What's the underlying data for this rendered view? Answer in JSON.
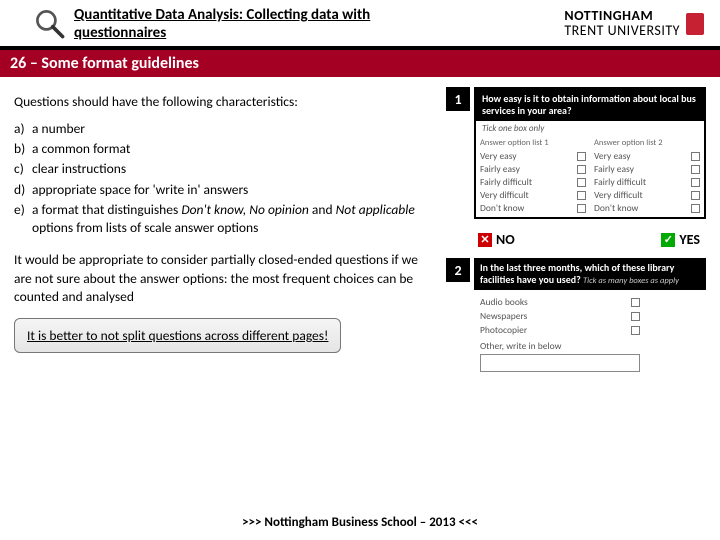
{
  "header": {
    "title": "Quantitative Data Analysis: Collecting data with questionnaires",
    "university_l1": "NOTTINGHAM",
    "university_l2": "TRENT UNIVERSITY"
  },
  "slide_title": "26 – Some format guidelines",
  "left": {
    "intro": "Questions should have the following characteristics:",
    "items": [
      {
        "k": "a)",
        "v": "a number"
      },
      {
        "k": "b)",
        "v": "a common format"
      },
      {
        "k": "c)",
        "v": "clear instructions"
      },
      {
        "k": "d)",
        "v": "appropriate space for 'write in' answers"
      },
      {
        "k": "e)",
        "v_pre": "a format that distinguishes ",
        "v_ital": "Don't know, No opinion",
        "v_mid": " and ",
        "v_ital2": "Not applicable",
        "v_post": " options from lists of scale answer options"
      }
    ],
    "para2": "It would be appropriate to consider partially closed-ended questions if we are not sure about the answer options: the most frequent choices can be counted and analysed",
    "callout": "It is better to not split questions across different pages!"
  },
  "right": {
    "ex1": {
      "num": "1",
      "q": "How easy is it to obtain information about local bus services in your area?",
      "tick": "Tick one box only",
      "col1_hdr": "Answer option list 1",
      "col2_hdr": "Answer option list 2",
      "opts1": [
        "Very easy",
        "Fairly easy",
        "Fairly difficult",
        "Very difficult",
        "Don't know"
      ],
      "opts2": [
        "Very easy",
        "Fairly easy",
        "Fairly difficult",
        "Very difficult",
        "Don't know"
      ]
    },
    "no_label": "NO",
    "yes_label": "YES",
    "ex2": {
      "num": "2",
      "q": "In the last three months, which of these library facilities have you used?",
      "tick": "Tick as many boxes as apply",
      "opts": [
        "Audio books",
        "Newspapers",
        "Photocopier"
      ],
      "write": "Other, write in below"
    }
  },
  "footer": ">>> Nottingham Business School – 2013 <<<"
}
